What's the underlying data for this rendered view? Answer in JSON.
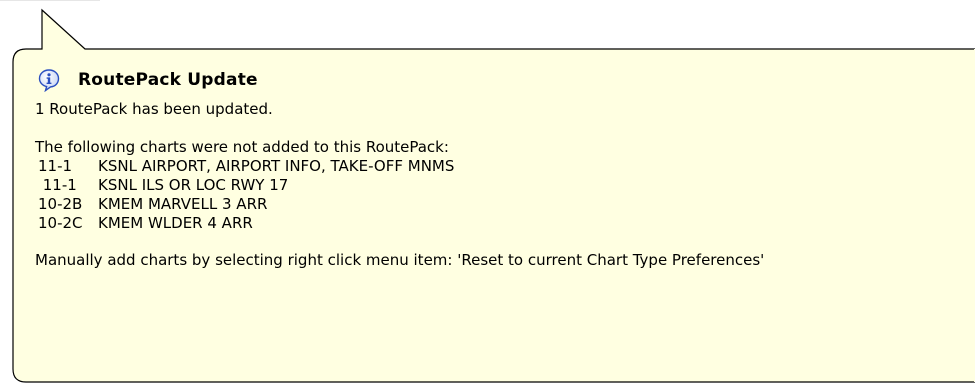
{
  "balloon": {
    "title": "RoutePack Update",
    "summary": "1 RoutePack has been updated.",
    "not_added_intro": "The following charts were not added to this RoutePack:",
    "charts": [
      {
        "code": "11-1",
        "description": "KSNL AIRPORT, AIRPORT INFO, TAKE-OFF MNMS"
      },
      {
        "code": " 11-1",
        "description": "KSNL ILS OR LOC RWY 17"
      },
      {
        "code": "10-2B",
        "description": "KMEM MARVELL 3 ARR"
      },
      {
        "code": "10-2C",
        "description": "KMEM WLDER 4 ARR"
      }
    ],
    "instruction": "Manually add charts by selecting right click menu item: 'Reset to current Chart Type Preferences'",
    "icon": "info-icon",
    "colors": {
      "background": "#ffffe1",
      "border": "#000000",
      "icon_blue": "#2b4fc0"
    }
  }
}
